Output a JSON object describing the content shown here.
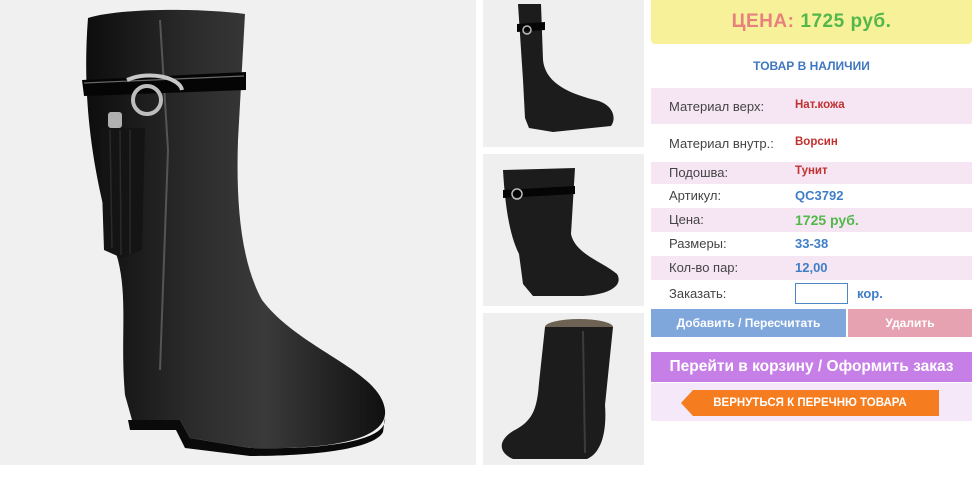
{
  "product": {
    "price_label": "ЦЕНА:",
    "price_value": "1725 руб.",
    "availability": "ТОВАР В НАЛИЧИИ",
    "properties": [
      {
        "label": "Материал верх:",
        "value": "Нат.кожа"
      },
      {
        "label": "Материал внутр.:",
        "value": "Ворсин"
      },
      {
        "label": "Подошва:",
        "value": "Тунит"
      },
      {
        "label": "Артикул:",
        "value": "QC3792"
      },
      {
        "label": "Цена:",
        "value": "1725 руб."
      },
      {
        "label": "Размеры:",
        "value": "33-38"
      },
      {
        "label": "Кол-во пар:",
        "value": "12,00"
      }
    ],
    "order": {
      "label": "Заказать:",
      "quantity": "",
      "unit": "кор."
    }
  },
  "buttons": {
    "add": "Добавить / Пересчитать",
    "delete": "Удалить",
    "cart": "Перейти в корзину / Оформить заказ",
    "back": "ВЕРНУТЬСЯ К ПЕРЕЧНЮ ТОВАРА"
  },
  "colors": {
    "price_banner": "#f7f19a",
    "price_label": "#e8807e",
    "price_value": "#52b84a",
    "accent_blue": "#3f78c0",
    "row_pink": "#f6e6f4",
    "add_button": "#7fa7dc",
    "delete_button": "#e7a2b2",
    "cart_button": "#c77fe8",
    "back_button": "#f57c1f"
  },
  "images": {
    "main": "black-leather-boot-photo",
    "thumbnails": [
      "boot-side-view",
      "boot-side-view-alt",
      "boot-inner-zipper-view"
    ]
  }
}
